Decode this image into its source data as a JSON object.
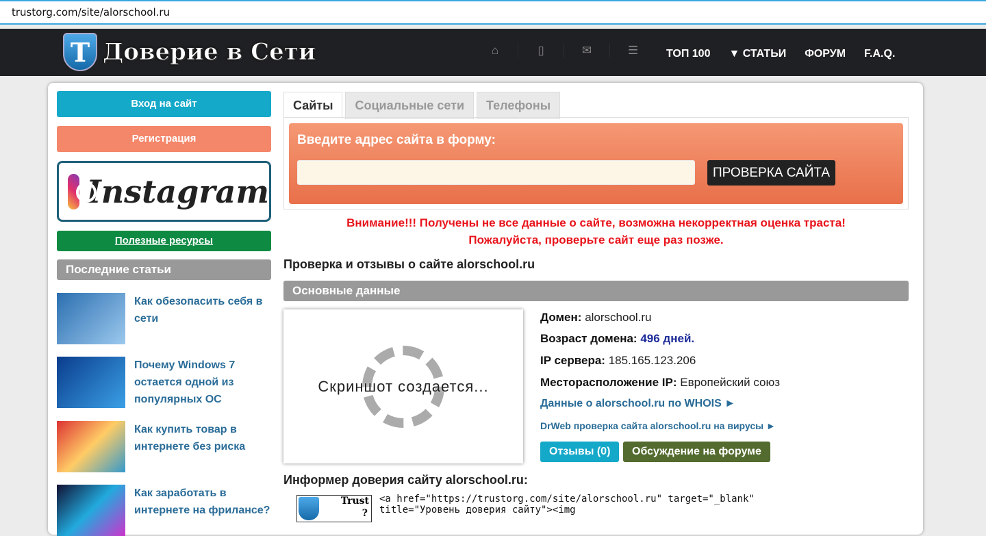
{
  "browser": {
    "address": "trustorg.com/site/alorschool.ru"
  },
  "header": {
    "logo_text": "Доверие в Сети",
    "logo_letter": "Т",
    "icons": [
      "home-icon",
      "mobile-icon",
      "mail-icon",
      "list-icon"
    ],
    "nav": [
      "ТОП 100",
      "▼ СТАТЬИ",
      "ФОРУМ",
      "F.A.Q."
    ]
  },
  "sidebar": {
    "login": "Вход на сайт",
    "register": "Регистрация",
    "instagram": "Instagram",
    "resources": "Полезные ресурсы",
    "latest": "Последние статьи",
    "articles": [
      {
        "title": "Как обезопасить себя в сети"
      },
      {
        "title": "Почему Windows 7 остается одной из популярных ОС"
      },
      {
        "title": "Как купить товар в интернете без риска"
      },
      {
        "title": "Как заработать в интернете на фрилансе?"
      }
    ]
  },
  "tabs": [
    "Сайты",
    "Социальные сети",
    "Телефоны"
  ],
  "form": {
    "label": "Введите адрес сайта в форму:",
    "input_value": "",
    "button": "ПРОВЕРКА САЙТА"
  },
  "warning": {
    "line1": "Внимание!!! Получены не все данные о сайте, возможна некорректная оценка траста!",
    "line2": "Пожалуйста, проверьте сайт еще раз позже."
  },
  "main": {
    "title": "Проверка и отзывы о сайте alorschool.ru",
    "section": "Основные данные",
    "screenshot_text": "Скриншот создается...",
    "domain_label": "Домен:",
    "domain": "alorschool.ru",
    "age_label": "Возраст домена:",
    "age": "496 дней.",
    "ip_label": "IP сервера:",
    "ip": "185.165.123.206",
    "loc_label": "Месторасположение IP:",
    "loc": "Европейский союз",
    "whois": "Данные о alorschool.ru по WHOIS ►",
    "drweb": "DrWeb проверка сайта alorschool.ru на вирусы ►",
    "reviews": "Отзывы (0)",
    "forum": "Обсуждение на форуме"
  },
  "informer": {
    "title": "Информер доверия сайту alorschool.ru:",
    "badge_text": "Trust",
    "badge_q": "?",
    "code": "<a href=\"https://trustorg.com/site/alorschool.ru\" target=\"_blank\"\ntitle=\"Уровень доверия сайту\"><img"
  }
}
